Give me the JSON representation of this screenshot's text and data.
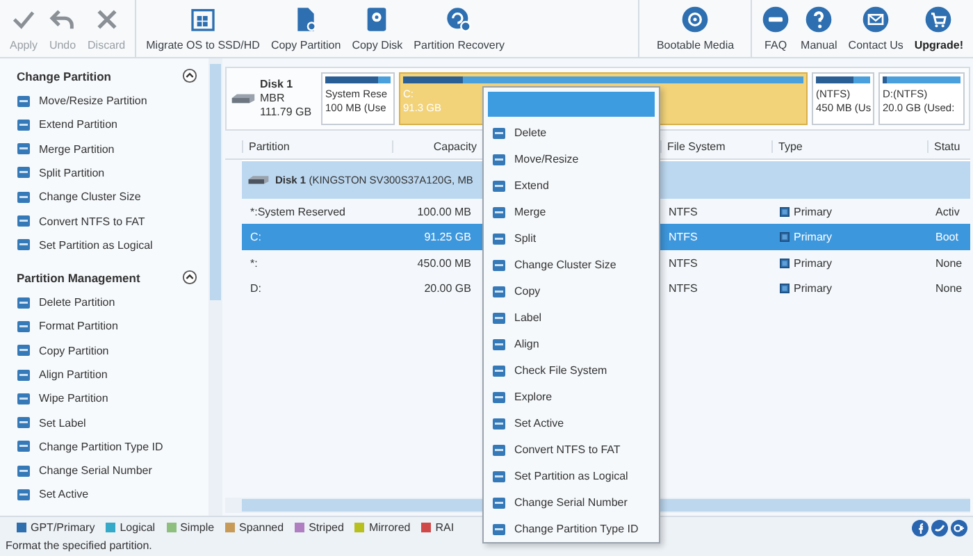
{
  "toolbar": {
    "groups": [
      {
        "buttons": [
          {
            "label": "Apply",
            "disabled": true,
            "bold": false
          },
          {
            "label": "Undo",
            "disabled": true,
            "bold": false
          },
          {
            "label": "Discard",
            "disabled": true,
            "bold": false
          }
        ]
      },
      {
        "buttons": [
          {
            "label": "Migrate OS to SSD/HD",
            "disabled": false,
            "bold": false
          },
          {
            "label": "Copy Partition",
            "disabled": false,
            "bold": false
          },
          {
            "label": "Copy Disk",
            "disabled": false,
            "bold": false
          },
          {
            "label": "Partition Recovery",
            "disabled": false,
            "bold": false
          }
        ]
      },
      {
        "buttons": [
          {
            "label": "Bootable Media",
            "disabled": false,
            "bold": false
          }
        ]
      },
      {
        "buttons": [
          {
            "label": "FAQ",
            "disabled": false,
            "bold": false
          },
          {
            "label": "Manual",
            "disabled": false,
            "bold": false
          },
          {
            "label": "Contact Us",
            "disabled": false,
            "bold": false
          },
          {
            "label": "Upgrade!",
            "disabled": false,
            "bold": true
          }
        ]
      }
    ]
  },
  "sidebar": {
    "sections": [
      {
        "title": "Change Partition",
        "expanded": true,
        "items": [
          "Move/Resize Partition",
          "Extend Partition",
          "Merge Partition",
          "Split Partition",
          "Change Cluster Size",
          "Convert NTFS to FAT",
          "Set Partition as Logical"
        ]
      },
      {
        "title": "Partition Management",
        "expanded": true,
        "items": [
          "Delete Partition",
          "Format Partition",
          "Copy Partition",
          "Align Partition",
          "Wipe Partition",
          "Set Label",
          "Change Partition Type ID",
          "Change Serial Number",
          "Set Active"
        ]
      }
    ]
  },
  "disk_map": {
    "disk": {
      "name": "Disk 1",
      "type": "MBR",
      "size": "111.79 GB"
    },
    "partitions": [
      {
        "name": "System Rese",
        "size": "100 MB (Use",
        "level": 0.8,
        "selected": false
      },
      {
        "name": "C:",
        "size": "91.3 GB",
        "level": 0.15,
        "selected": true
      },
      {
        "name": "(NTFS)",
        "size": "450 MB (Us",
        "level": 0.7,
        "selected": false
      },
      {
        "name": "D:(NTFS)",
        "size": "20.0 GB (Used:",
        "level": 0.05,
        "selected": false
      }
    ]
  },
  "table": {
    "columns": [
      "Partition",
      "Capacity",
      "File System",
      "Type",
      "Statu"
    ],
    "disk_row": "**Disk 1** (KINGSTON SV300S37A120G, MB",
    "rows": [
      {
        "cells": [
          "*:System Reserved",
          "100.00 MB",
          "NTFS",
          "Primary",
          "Activ"
        ],
        "selected": false
      },
      {
        "cells": [
          "C:",
          "91.25 GB",
          "NTFS",
          "Primary",
          "Boot"
        ],
        "selected": true
      },
      {
        "cells": [
          "*:",
          "450.00 MB",
          "NTFS",
          "Primary",
          "None"
        ],
        "selected": false
      },
      {
        "cells": [
          "D:",
          "20.00 GB",
          "NTFS",
          "Primary",
          "None"
        ],
        "selected": false
      }
    ]
  },
  "context_menu": {
    "items": [
      "Delete",
      "Move/Resize",
      "Extend",
      "Merge",
      "Split",
      "Change Cluster Size",
      "Copy",
      "Label",
      "Align",
      "Check File System",
      "Explore",
      "Set Active",
      "Convert NTFS to FAT",
      "Set Partition as Logical",
      "Change Serial Number",
      "Change Partition Type ID"
    ]
  },
  "legend": [
    {
      "label": "GPT/Primary",
      "color": "#2f6fae"
    },
    {
      "label": "Logical",
      "color": "#36a9c9"
    },
    {
      "label": "Simple",
      "color": "#8fbf7f"
    },
    {
      "label": "Spanned",
      "color": "#c89a58"
    },
    {
      "label": "Striped",
      "color": "#b07fc2"
    },
    {
      "label": "Mirrored",
      "color": "#b8c020"
    },
    {
      "label": "RAI",
      "color": "#d04848"
    }
  ],
  "status_bar": "Format the specified partition."
}
